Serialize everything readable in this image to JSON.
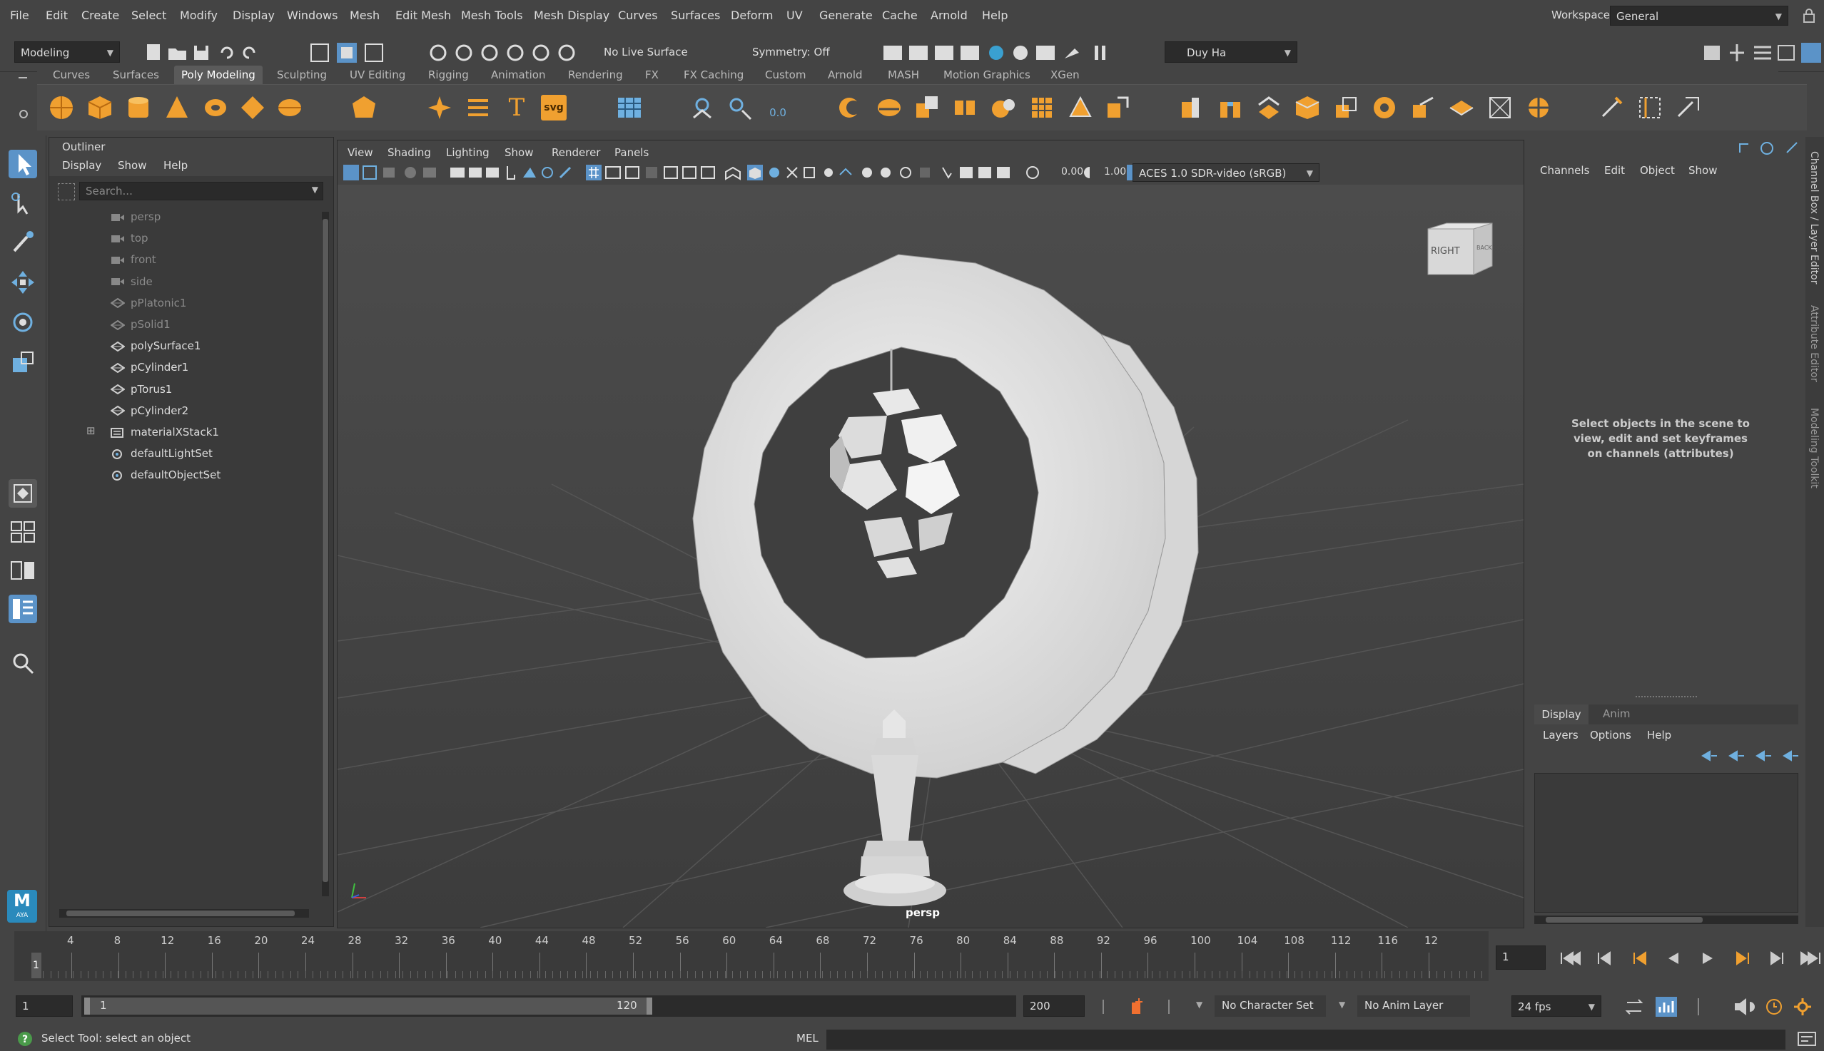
{
  "menubar": {
    "items": [
      "File",
      "Edit",
      "Create",
      "Select",
      "Modify",
      "Display",
      "Windows",
      "Mesh",
      "Edit Mesh",
      "Mesh Tools",
      "Mesh Display",
      "Curves",
      "Surfaces",
      "Deform",
      "UV",
      "Generate",
      "Cache",
      "Arnold",
      "Help"
    ],
    "workspace_label": "Workspace:",
    "workspace_value": "General"
  },
  "statusline": {
    "mode": "Modeling",
    "live_surface": "No Live Surface",
    "symmetry": "Symmetry: Off",
    "user": "Duy Ha"
  },
  "shelf": {
    "tabs": [
      "Curves",
      "Surfaces",
      "Poly Modeling",
      "Sculpting",
      "UV Editing",
      "Rigging",
      "Animation",
      "Rendering",
      "FX",
      "FX Caching",
      "Custom",
      "Arnold",
      "MASH",
      "Motion Graphics",
      "XGen"
    ],
    "active_tab": "Poly Modeling",
    "text_icon_label": "T",
    "svg_icon_label": "svg",
    "zero_label": "0.0"
  },
  "outliner": {
    "title": "Outliner",
    "menus": [
      "Display",
      "Show",
      "Help"
    ],
    "search_placeholder": "Search...",
    "items": [
      {
        "label": "persp",
        "dim": true,
        "icon": "camera-icon"
      },
      {
        "label": "top",
        "dim": true,
        "icon": "camera-icon"
      },
      {
        "label": "front",
        "dim": true,
        "icon": "camera-icon"
      },
      {
        "label": "side",
        "dim": true,
        "icon": "camera-icon"
      },
      {
        "label": "pPlatonic1",
        "dim": true,
        "icon": "mesh-icon"
      },
      {
        "label": "pSolid1",
        "dim": true,
        "icon": "mesh-icon"
      },
      {
        "label": "polySurface1",
        "dim": false,
        "icon": "mesh-icon"
      },
      {
        "label": "pCylinder1",
        "dim": false,
        "icon": "mesh-icon"
      },
      {
        "label": "pTorus1",
        "dim": false,
        "icon": "mesh-icon"
      },
      {
        "label": "pCylinder2",
        "dim": false,
        "icon": "mesh-icon"
      },
      {
        "label": "materialXStack1",
        "dim": false,
        "icon": "stack-icon"
      },
      {
        "label": "defaultLightSet",
        "dim": false,
        "icon": "set-icon"
      },
      {
        "label": "defaultObjectSet",
        "dim": false,
        "icon": "set-icon"
      }
    ]
  },
  "viewport": {
    "menus": [
      "View",
      "Shading",
      "Lighting",
      "Show",
      "Renderer",
      "Panels"
    ],
    "exposure": "0.00",
    "gamma": "1.00",
    "color_space": "ACES 1.0 SDR-video (sRGB)",
    "camera_label": "persp",
    "viewcube_right": "RIGHT",
    "viewcube_back": "BACK"
  },
  "channelbox": {
    "menus": [
      "Channels",
      "Edit",
      "Object",
      "Show"
    ],
    "hint": "Select objects in the scene to view, edit and set keyframes on channels (attributes)",
    "side_tabs": [
      "Channel Box / Layer Editor",
      "Attribute Editor",
      "Modeling Toolkit"
    ]
  },
  "layers": {
    "tabs": [
      "Display",
      "Anim"
    ],
    "menus": [
      "Layers",
      "Options",
      "Help"
    ]
  },
  "timeline": {
    "ticks": [
      "4",
      "8",
      "12",
      "16",
      "20",
      "24",
      "28",
      "32",
      "36",
      "40",
      "44",
      "48",
      "52",
      "56",
      "60",
      "64",
      "68",
      "72",
      "76",
      "80",
      "84",
      "88",
      "92",
      "96",
      "100",
      "104",
      "108",
      "112",
      "116",
      "12"
    ],
    "start_marker": "1",
    "current_frame": "1"
  },
  "range": {
    "start": "1",
    "inner_start": "1",
    "inner_end": "120",
    "end": "200",
    "character_set": "No Character Set",
    "anim_layer": "No Anim Layer",
    "fps": "24 fps"
  },
  "cmdline": {
    "help_text": "Select Tool: select an object",
    "mel_label": "MEL"
  },
  "logo": {
    "label": "M",
    "sub": "AYA"
  }
}
